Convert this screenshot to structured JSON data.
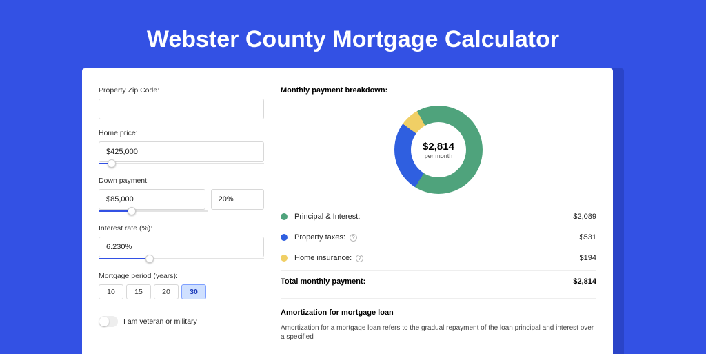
{
  "title": "Webster County Mortgage Calculator",
  "form": {
    "zip_label": "Property Zip Code:",
    "zip_value": "",
    "home_price_label": "Home price:",
    "home_price_value": "$425,000",
    "down_payment_label": "Down payment:",
    "down_payment_value": "$85,000",
    "down_payment_pct": "20%",
    "interest_label": "Interest rate (%):",
    "interest_value": "6.230%",
    "period_label": "Mortgage period (years):",
    "periods": [
      "10",
      "15",
      "20",
      "30"
    ],
    "period_selected": "30",
    "veteran_label": "I am veteran or military"
  },
  "breakdown": {
    "title": "Monthly payment breakdown:",
    "donut_amount": "$2,814",
    "donut_sub": "per month",
    "rows": [
      {
        "label": "Principal & Interest:",
        "value": "$2,089",
        "color": "#4fa37c",
        "info": false
      },
      {
        "label": "Property taxes:",
        "value": "$531",
        "color": "#2f5fe0",
        "info": true
      },
      {
        "label": "Home insurance:",
        "value": "$194",
        "color": "#f0cf65",
        "info": true
      }
    ],
    "total_label": "Total monthly payment:",
    "total_value": "$2,814"
  },
  "amort": {
    "title": "Amortization for mortgage loan",
    "text": "Amortization for a mortgage loan refers to the gradual repayment of the loan principal and interest over a specified"
  },
  "chart_data": {
    "type": "pie",
    "title": "Monthly payment breakdown",
    "series": [
      {
        "name": "Principal & Interest",
        "value": 2089,
        "color": "#4fa37c"
      },
      {
        "name": "Property taxes",
        "value": 531,
        "color": "#2f5fe0"
      },
      {
        "name": "Home insurance",
        "value": 194,
        "color": "#f0cf65"
      }
    ],
    "total": 2814,
    "center_label": "$2,814 per month"
  }
}
